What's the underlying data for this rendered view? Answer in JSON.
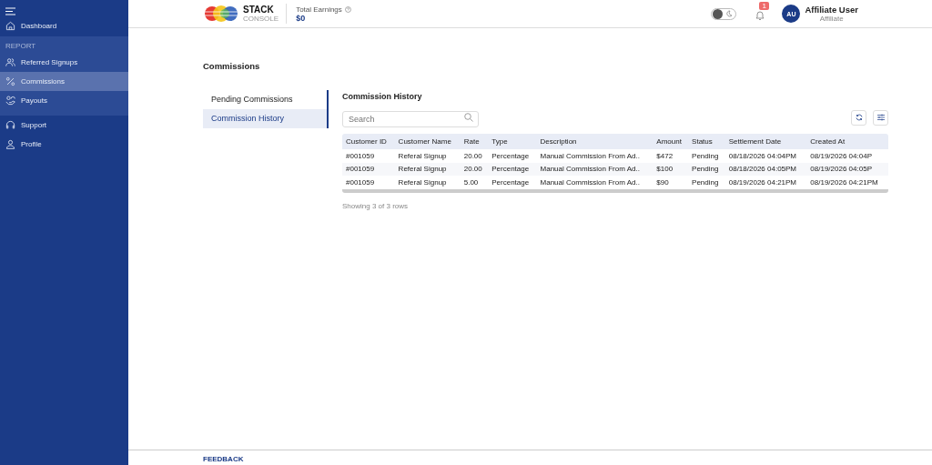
{
  "sidebar": {
    "items": [
      {
        "kind": "link",
        "label": "Dashboard",
        "selected": false
      },
      {
        "kind": "section",
        "label": "REPORT"
      },
      {
        "kind": "link",
        "label": "Referred Signups",
        "selected": false
      },
      {
        "kind": "link",
        "label": "Commissions",
        "selected": true
      },
      {
        "kind": "link",
        "label": "Payouts",
        "selected": false
      },
      {
        "kind": "link",
        "label": "Support",
        "selected": false
      },
      {
        "kind": "link",
        "label": "Profile",
        "selected": false
      }
    ]
  },
  "header": {
    "dark_mode": false,
    "logo": {
      "name": "STACK",
      "sub": "CONSOLE"
    },
    "earnings_label": "Total Earnings",
    "earnings_value": "$0",
    "notification_badge": "1",
    "user": {
      "initials": "AU",
      "name": "Affiliate User",
      "role": "Affiliate"
    }
  },
  "page_title": "Commissions",
  "subnav": [
    {
      "label": "Pending Commissions",
      "selected": false
    },
    {
      "label": "Commission History",
      "selected": true
    }
  ],
  "section_title": "Commission History",
  "search": {
    "placeholder": "Search"
  },
  "table": {
    "columns": [
      "Customer ID",
      "Customer Name",
      "Rate",
      "Type",
      "Description",
      "Amount",
      "Status",
      "Settlement Date",
      "Created At"
    ],
    "rows": [
      [
        "#001059",
        "Referal Signup",
        "20.00",
        "Percentage",
        "Manual Commission From Ad..",
        "$472",
        "Pending",
        "08/18/2026 04:04PM",
        "08/19/2026 04:04P"
      ],
      [
        "#001059",
        "Referal Signup",
        "20.00",
        "Percentage",
        "Manual Commission From Ad..",
        "$100",
        "Pending",
        "08/18/2026 04:05PM",
        "08/19/2026 04:05P"
      ],
      [
        "#001059",
        "Referal Signup",
        "5.00",
        "Percentage",
        "Manual Commission From Ad..",
        "$90",
        "Pending",
        "08/19/2026 04:21PM",
        "08/19/2026 04:21PM"
      ]
    ]
  },
  "table_footer": "Showing 3 of 3 rows",
  "footer": {
    "feedback": "FEEDBACK"
  }
}
